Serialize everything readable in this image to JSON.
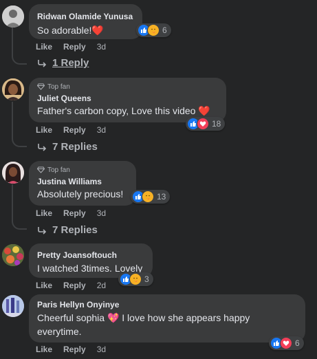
{
  "comments": [
    {
      "author": "Ridwan Olamide Yunusa",
      "text": "So adorable!",
      "emoji": "❤️",
      "reaction_count": "6",
      "reactions": [
        "like",
        "care"
      ],
      "actions": {
        "like": "Like",
        "reply": "Reply",
        "time": "3d"
      },
      "replies_label": "1 Reply"
    },
    {
      "badge": "Top fan",
      "author": "Juliet Queens",
      "text": "Father's carbon copy, Love this video",
      "emoji": "❤️",
      "reaction_count": "18",
      "reactions": [
        "like",
        "love"
      ],
      "actions": {
        "like": "Like",
        "reply": "Reply",
        "time": "3d"
      },
      "replies_label": "7 Replies"
    },
    {
      "badge": "Top fan",
      "author": "Justina Williams",
      "text": "Absolutely precious!",
      "reaction_count": "13",
      "reactions": [
        "like",
        "care"
      ],
      "actions": {
        "like": "Like",
        "reply": "Reply",
        "time": "3d"
      },
      "replies_label": "7 Replies"
    },
    {
      "author": "Pretty Joansoftouch",
      "text": "I watched 3times. Lovely",
      "reaction_count": "3",
      "reactions": [
        "like",
        "care"
      ],
      "actions": {
        "like": "Like",
        "reply": "Reply",
        "time": "2d"
      }
    },
    {
      "author": "Paris Hellyn Onyinye",
      "text_part1": "Cheerful sophia",
      "emoji": "💖",
      "text_part2": "I love how she appears happy",
      "text_line2": "everytime.",
      "reaction_count": "6",
      "reactions": [
        "like",
        "love"
      ],
      "actions": {
        "like": "Like",
        "reply": "Reply",
        "time": "3d"
      }
    }
  ],
  "colors": {
    "background": "#242526",
    "bubble": "#3a3b3c",
    "like": "#1877f2",
    "love": "#f33e58",
    "care": "#f7b125",
    "secondary_text": "#b0b3b8"
  },
  "icons": [
    "top-fan-diamond-icon",
    "reply-arrow-icon",
    "like-reaction-icon",
    "love-reaction-icon",
    "care-reaction-icon"
  ]
}
